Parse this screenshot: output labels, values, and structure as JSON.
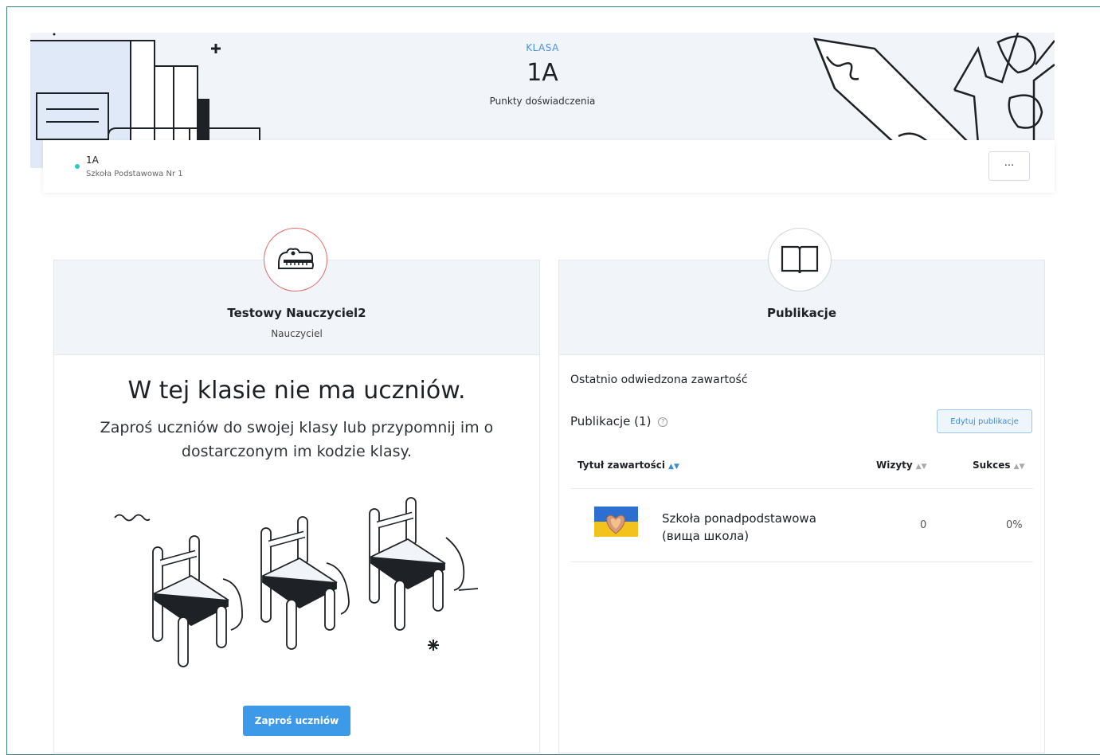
{
  "hero": {
    "label": "KLASA",
    "title": "1A",
    "subtitle": "Punkty doświadczenia"
  },
  "classbar": {
    "name": "1A",
    "school": "Szkoła Podstawowa Nr 1",
    "more_label": "···"
  },
  "teacher": {
    "name": "Testowy Nauczyciel2",
    "role": "Nauczyciel"
  },
  "empty_state": {
    "title": "W tej klasie nie ma uczniów.",
    "text": "Zaproś uczniów do swojej klasy lub przypomnij im o dostarczonym im kodzie klasy.",
    "button": "Zaproś uczniów"
  },
  "publications": {
    "header": "Publikacje",
    "recent_label": "Ostatnio odwiedzona zawartość",
    "count_label": "Publikacje (1)",
    "help": "?",
    "edit_button": "Edytuj publikacje",
    "columns": {
      "title": "Tytuł zawartości",
      "visits": "Wizyty",
      "success": "Sukces"
    },
    "rows": [
      {
        "title": "Szkoła ponadpodstawowa (вища школа)",
        "visits": "0",
        "success": "0%"
      }
    ]
  },
  "colors": {
    "accent": "#3d9ae8",
    "teacher_ring": "#e36b64",
    "status": "#2bc8c8"
  }
}
